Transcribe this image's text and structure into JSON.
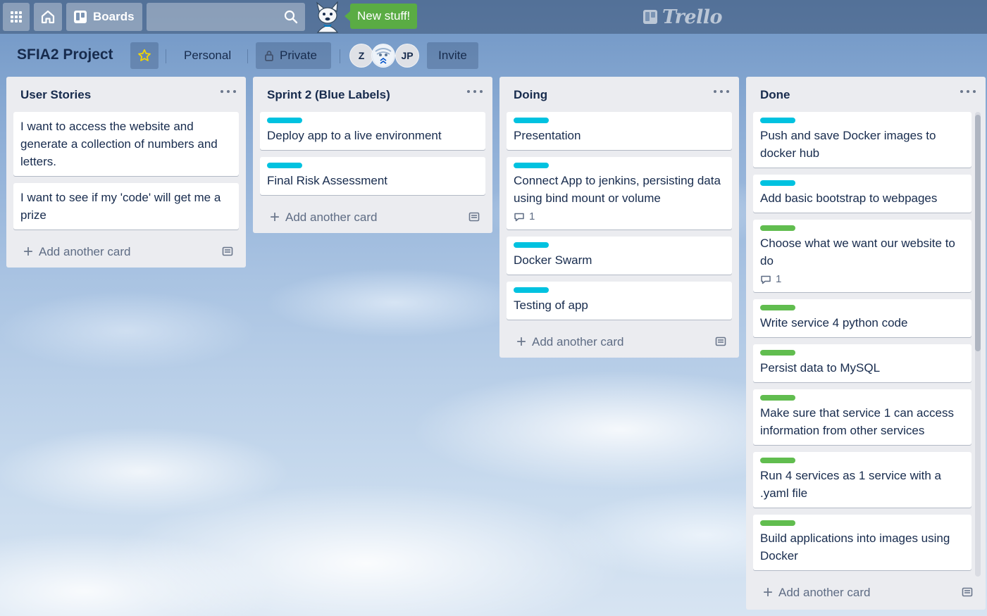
{
  "header": {
    "boards_label": "Boards",
    "search_value": "",
    "new_stuff_label": "New stuff!",
    "logo_text": "Trello"
  },
  "board": {
    "title": "SFIA2 Project",
    "team_label": "Personal",
    "visibility_label": "Private",
    "invite_label": "Invite",
    "members": [
      "Z",
      "JP"
    ]
  },
  "lists": [
    {
      "title": "User Stories",
      "cards": [
        {
          "text": "I want to access the website and generate a collection of numbers and letters."
        },
        {
          "text": "I want to see if my 'code' will get me a prize"
        }
      ],
      "add_label": "Add another card"
    },
    {
      "title": "Sprint 2 (Blue Labels)",
      "cards": [
        {
          "label": "blue",
          "text": "Deploy app to a live environment"
        },
        {
          "label": "blue",
          "text": "Final Risk Assessment"
        }
      ],
      "add_label": "Add another card"
    },
    {
      "title": "Doing",
      "cards": [
        {
          "label": "blue",
          "text": "Presentation"
        },
        {
          "label": "blue",
          "text": "Connect App to jenkins, persisting data using bind mount or volume",
          "comments": "1"
        },
        {
          "label": "blue",
          "text": "Docker Swarm"
        },
        {
          "label": "blue",
          "text": "Testing of app"
        }
      ],
      "add_label": "Add another card"
    },
    {
      "title": "Done",
      "cards": [
        {
          "label": "blue",
          "text": "Push and save Docker images to docker hub"
        },
        {
          "label": "blue",
          "text": "Add basic bootstrap to webpages"
        },
        {
          "label": "green",
          "text": "Choose what we want our website to do",
          "comments": "1"
        },
        {
          "label": "green",
          "text": "Write service 4 python code"
        },
        {
          "label": "green",
          "text": "Persist data to MySQL"
        },
        {
          "label": "green",
          "text": "Make sure that service 1 can access information from other services"
        },
        {
          "label": "green",
          "text": "Run 4 services as 1 service with a .yaml file"
        },
        {
          "label": "green",
          "text": "Build applications into images using Docker"
        }
      ],
      "add_label": "Add another card"
    }
  ],
  "colors": {
    "label_blue": "#00c2e0",
    "label_green": "#61bd4f",
    "new_stuff": "#5aac44",
    "list_bg": "#ebecf0",
    "star": "#f2d600"
  },
  "icons": [
    "apps-grid-icon",
    "home-icon",
    "boards-icon",
    "search-icon",
    "star-icon",
    "lock-icon",
    "comment-icon",
    "card-template-icon",
    "plus-icon",
    "list-menu-icon"
  ]
}
